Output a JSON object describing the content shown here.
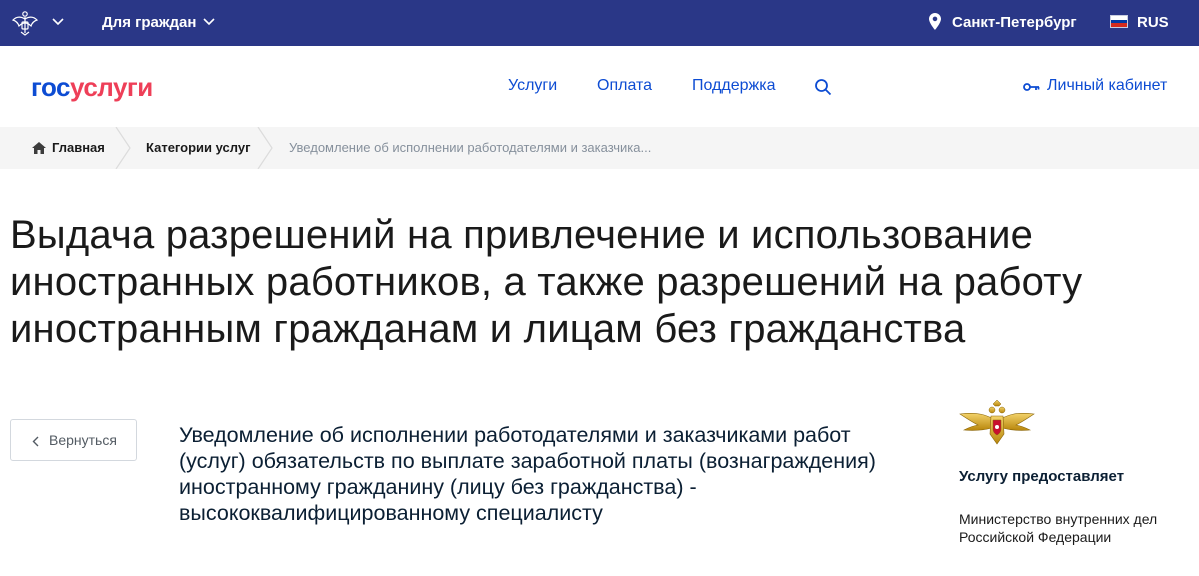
{
  "topbar": {
    "for_citizens": "Для граждан",
    "city": "Санкт-Петербург",
    "lang": "RUS",
    "icons": [
      "coat-of-arms-icon",
      "chevron-down-icon",
      "location-pin-icon",
      "russian-flag-icon"
    ],
    "flag_colors": [
      "#ffffff",
      "#0039a6",
      "#d52b1e"
    ],
    "background": "#2a3787"
  },
  "header": {
    "logo_part1": "гос",
    "logo_part2": "услуги",
    "nav": [
      "Услуги",
      "Оплата",
      "Поддержка"
    ],
    "cabinet": "Личный кабинет",
    "icons": [
      "search-icon",
      "key-icon"
    ],
    "accent": "#0d4cd3",
    "logo_accent": "#ee3f58"
  },
  "breadcrumbs": {
    "home": "Главная",
    "categories": "Категории услуг",
    "current": "Уведомление об исполнении работодателями и заказчика..."
  },
  "page": {
    "title": "Выдача разрешений на привлечение и использование иностранных работников, а также разрешений на работу иностранным гражданам и лицам без гражданства",
    "back": "Вернуться",
    "service_title": "Уведомление об исполнении работодателями и заказчиками работ (услуг) обязательств по выплате заработной платы (вознаграждения) иностранному гражданину (лицу без гражданства) - высококвалифицированному специалисту"
  },
  "provider": {
    "label": "Услугу предоставляет",
    "name": "Министерство внутренних дел Российской Федерации",
    "icon": "mvd-emblem-icon"
  }
}
